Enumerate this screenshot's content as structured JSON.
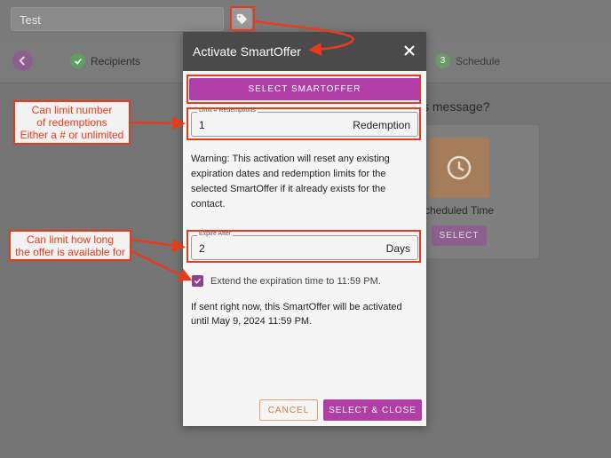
{
  "background": {
    "name_input_value": "Test",
    "steps": [
      {
        "label": "Recipients",
        "state": "done"
      },
      {
        "label": "Schedule",
        "number": "3"
      }
    ],
    "question_fragment": "s message?",
    "scheduled_time_label": "cheduled Time",
    "select_label": "SELECT"
  },
  "modal": {
    "title": "Activate SmartOffer",
    "select_smartoffer_label": "SELECT SMARTOFFER",
    "limit_field": {
      "legend": "Limit # Redemptions",
      "value": "1",
      "suffix": "Redemption"
    },
    "warning": "Warning: This activation will reset any existing expiration dates and redemption limits for the selected SmartOffer if it already exists for the contact.",
    "expire_field": {
      "legend": "Expire After",
      "value": "2",
      "suffix": "Days"
    },
    "extend_checkbox": {
      "checked": true,
      "label": "Extend the expiration time to 11:59 PM."
    },
    "activation_note": "If sent right now, this SmartOffer will be activated until May 9, 2024 11:59 PM.",
    "cancel_label": "CANCEL",
    "select_close_label": "SELECT & CLOSE"
  },
  "annotations": {
    "callout_redemptions": [
      "Can limit number",
      "of redemptions",
      "Either a # or unlimited"
    ],
    "callout_expire": [
      "Can limit how long",
      "the offer is available for"
    ]
  },
  "colors": {
    "accent": "#b13ea6",
    "annotation": "#e53c1d",
    "cancel": "#d07a3a"
  }
}
